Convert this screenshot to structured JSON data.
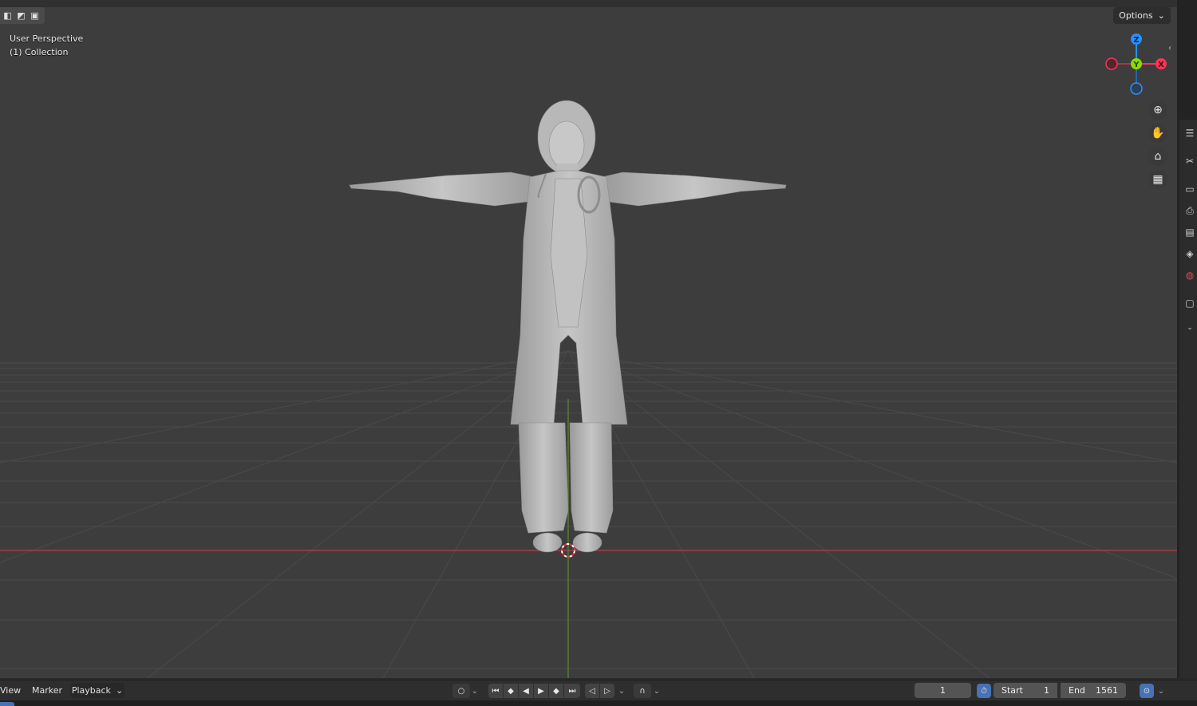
{
  "viewport": {
    "overlay_line1": "User Perspective",
    "overlay_line2": "(1) Collection",
    "options_label": "Options"
  },
  "gizmo": {
    "z": "Z",
    "y": "Y",
    "x": "X"
  },
  "colors": {
    "x_axis": "#ff3352",
    "y_axis": "#8bdc00",
    "z_axis": "#2890ff",
    "accent": "#4772b3"
  },
  "nav_icons": [
    "zoom-icon",
    "pan-hand-icon",
    "camera-icon",
    "grid-ortho-icon"
  ],
  "timeline": {
    "menu_view": "View",
    "menu_marker": "Marker",
    "playback_label": "Playback",
    "current_frame": "1",
    "start_label": "Start",
    "start_value": "1",
    "end_label": "End",
    "end_value": "1561"
  }
}
